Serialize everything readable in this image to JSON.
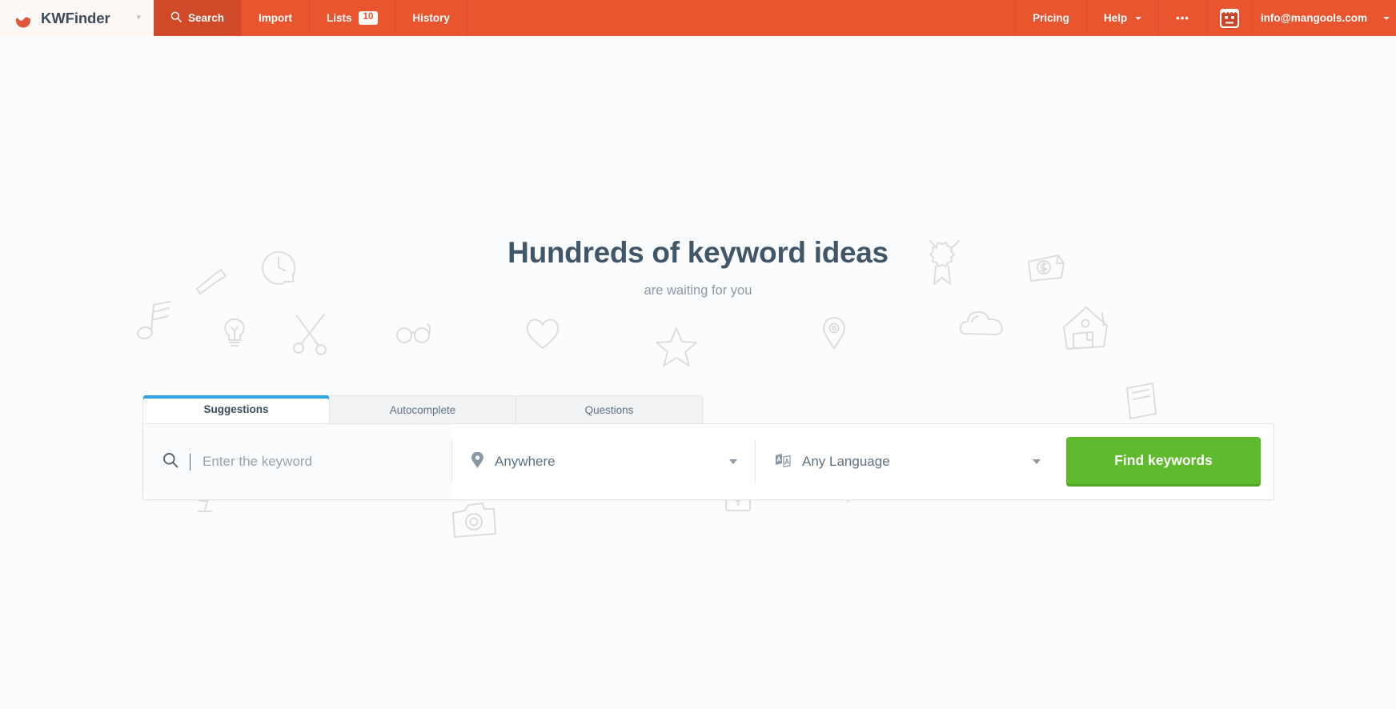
{
  "navbar": {
    "brand": {
      "name": "KWFinder",
      "logo_icon": "kwfinder-droplet-logo",
      "caret_icon": "chevron-down-icon"
    },
    "items": [
      {
        "label": "Search",
        "icon": "search-icon",
        "active": true
      },
      {
        "label": "Import",
        "icon": "",
        "active": false
      },
      {
        "label": "Lists",
        "icon": "",
        "badge": "10",
        "active": false
      },
      {
        "label": "History",
        "icon": "",
        "active": false
      }
    ],
    "right_items": [
      {
        "label": "Pricing",
        "icon": ""
      },
      {
        "label": "Help",
        "icon": "chevron-down-icon"
      },
      {
        "label": "•••",
        "icon": "more-dots-icon"
      }
    ],
    "avatar_icon": "robot-avatar-icon",
    "user_email": "info@mangools.com",
    "edge_caret_icon": "chevron-down-icon",
    "colors": {
      "bar": "#e8552f",
      "active_tab": "#d04a28",
      "brand_bg": "#fdf8f4"
    }
  },
  "hero": {
    "headline": "Hundreds of keyword ideas",
    "subheadline": "are waiting for you",
    "doodle_icons": [
      "music-note-icon",
      "pen-icon",
      "clock-icon",
      "lightbulb-icon",
      "scissors-icon",
      "glasses-icon",
      "heart-icon",
      "star-icon",
      "map-pin-icon",
      "award-ribbon-icon",
      "money-icon",
      "cloud-icon",
      "house-icon",
      "alien-icon",
      "sun-icon",
      "wifi-icon",
      "smartphone-icon",
      "globe-icon",
      "camera-icon",
      "lock-icon",
      "magnifier-icon",
      "calendar-icon",
      "anchor-icon",
      "bubble-icon"
    ]
  },
  "search_panel": {
    "tabs": [
      {
        "label": "Suggestions",
        "active": true
      },
      {
        "label": "Autocomplete",
        "active": false
      },
      {
        "label": "Questions",
        "active": false
      }
    ],
    "keyword_field": {
      "placeholder": "Enter the keyword",
      "value": "",
      "icon": "search-icon"
    },
    "location_field": {
      "value": "Anywhere",
      "icon": "map-pin-icon",
      "caret_icon": "chevron-down-icon"
    },
    "language_field": {
      "value": "Any Language",
      "icon": "translate-icon",
      "caret_icon": "chevron-down-icon"
    },
    "submit_button": {
      "label": "Find keywords",
      "color": "#5fbb2d"
    },
    "active_tab_accent": "#2fa3e0"
  }
}
